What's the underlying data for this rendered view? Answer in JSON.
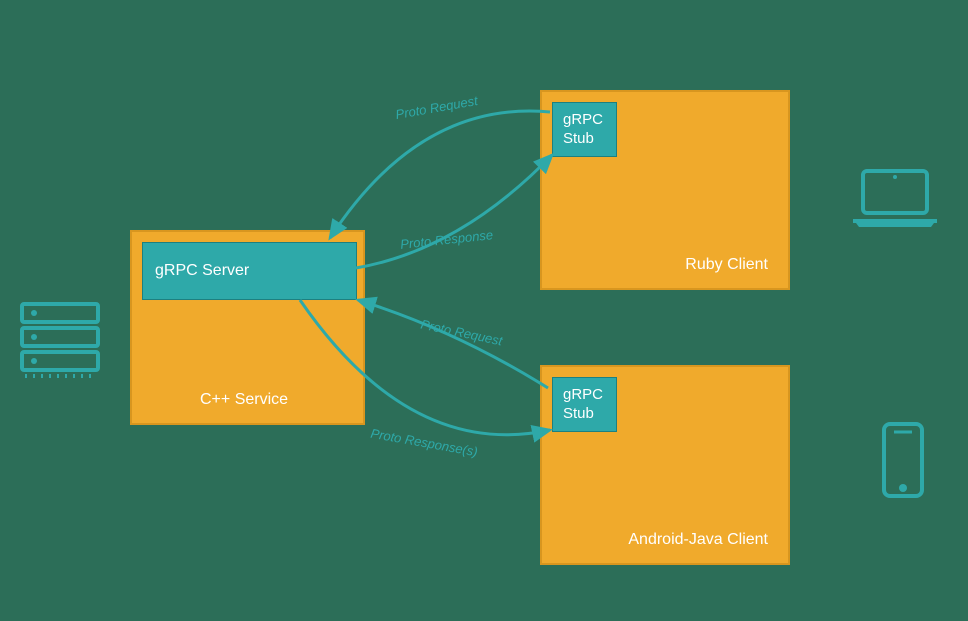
{
  "server": {
    "boxLabel": "C++ Service",
    "innerLabel": "gRPC Server"
  },
  "client1": {
    "boxLabel": "Ruby Client",
    "stubLine1": "gRPC",
    "stubLine2": "Stub"
  },
  "client2": {
    "boxLabel": "Android-Java Client",
    "stubLine1": "gRPC",
    "stubLine2": "Stub"
  },
  "arrows": {
    "req1": "Proto Request",
    "resp1": "Proto Response",
    "req2": "Proto Request",
    "resp2": "Proto Response(s)"
  },
  "colors": {
    "bg": "#2c6e58",
    "boxFill": "#f0aa2c",
    "boxBorder": "#d8961f",
    "accent": "#2ea9a9"
  }
}
